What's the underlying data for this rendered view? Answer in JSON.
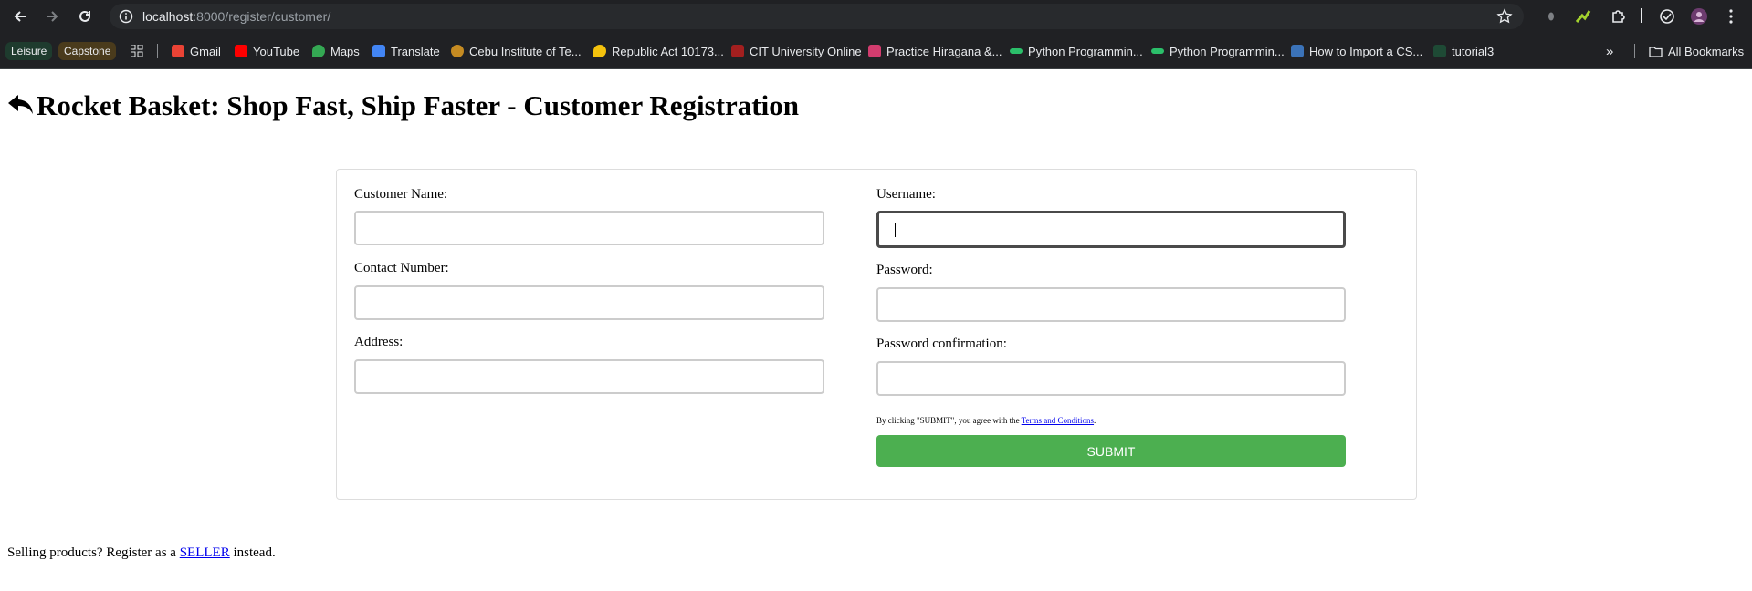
{
  "browser": {
    "url_host": "localhost",
    "url_rest": ":8000/register/customer/",
    "bookmarks": {
      "chips": [
        "Leisure",
        "Capstone"
      ],
      "items": [
        {
          "label": "Gmail",
          "icon": "gmail-icon",
          "color": "#ea4335"
        },
        {
          "label": "YouTube",
          "icon": "youtube-icon",
          "color": "#ff0000"
        },
        {
          "label": "Maps",
          "icon": "maps-icon",
          "color": "#34a853"
        },
        {
          "label": "Translate",
          "icon": "translate-icon",
          "color": "#4285f4"
        },
        {
          "label": "Cebu Institute of Te...",
          "icon": "cit-icon",
          "color": "#c58b22"
        },
        {
          "label": "Republic Act 10173...",
          "icon": "pin-icon",
          "color": "#f4c20d"
        },
        {
          "label": "CIT University Online",
          "icon": "cit-online-icon",
          "color": "#a31f1f"
        },
        {
          "label": "Practice Hiragana &...",
          "icon": "hiragana-icon",
          "color": "#d23c6e"
        },
        {
          "label": "Python Programmin...",
          "icon": "python-icon",
          "color": "#2bbf6a"
        },
        {
          "label": "Python Programmin...",
          "icon": "python-icon",
          "color": "#2bbf6a"
        },
        {
          "label": "How to Import a CS...",
          "icon": "py-icon",
          "color": "#3b73b9"
        },
        {
          "label": "tutorial3",
          "icon": "tutorial-icon",
          "color": "#1e4a35"
        }
      ],
      "all_bookmarks": "All Bookmarks"
    }
  },
  "page": {
    "title": "Rocket Basket: Shop Fast, Ship Faster - Customer Registration",
    "form": {
      "customer_name_label": "Customer Name:",
      "contact_number_label": "Contact Number:",
      "address_label": "Address:",
      "username_label": "Username:",
      "password_label": "Password:",
      "password_confirmation_label": "Password confirmation:",
      "terms_prefix": "By clicking \"SUBMIT\", you agree with the ",
      "terms_link": "Terms and Conditions",
      "terms_suffix": ".",
      "submit_label": "SUBMIT",
      "values": {
        "customer_name": "",
        "contact_number": "",
        "address": "",
        "username": "",
        "password": "",
        "password_confirmation": ""
      }
    },
    "footer": {
      "prefix": "Selling products? Register as a ",
      "link": "SELLER",
      "suffix": " instead."
    }
  },
  "colors": {
    "chrome_bg": "#202124",
    "omnibox_bg": "#282a2d",
    "submit_bg": "#4caf50",
    "link": "#0000ee"
  }
}
